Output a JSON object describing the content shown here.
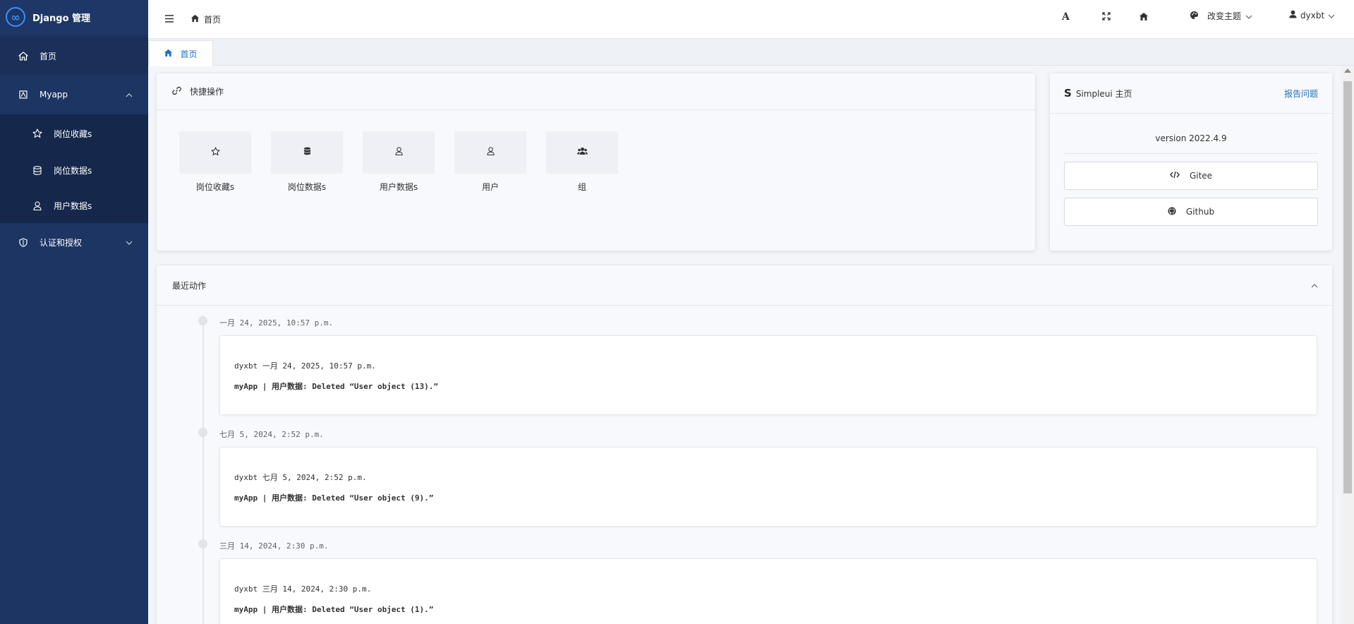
{
  "app": {
    "title": "Django 管理",
    "logo_glyph": "∞"
  },
  "sidebar": {
    "home_label": "首页",
    "groups": [
      {
        "label": "Myapp",
        "expanded": true,
        "items": [
          {
            "label": "岗位收藏s",
            "icon": "star-icon"
          },
          {
            "label": "岗位数据s",
            "icon": "database-icon"
          },
          {
            "label": "用户数据s",
            "icon": "user-icon"
          }
        ]
      },
      {
        "label": "认证和授权",
        "expanded": false
      }
    ]
  },
  "header": {
    "breadcrumb": "首页",
    "font_icon": "A",
    "theme_label": "改变主题",
    "user_name": "dyxbt"
  },
  "tabs": [
    {
      "label": "首页",
      "active": true
    }
  ],
  "quick": {
    "title": "快捷操作",
    "items": [
      {
        "label": "岗位收藏s",
        "icon": "star-icon"
      },
      {
        "label": "岗位数据s",
        "icon": "database-icon"
      },
      {
        "label": "用户数据s",
        "icon": "user-icon"
      },
      {
        "label": "用户",
        "icon": "user-icon"
      },
      {
        "label": "组",
        "icon": "users-icon"
      }
    ]
  },
  "simpleui": {
    "logo": "S",
    "title": "Simpleui 主页",
    "report_label": "报告问题",
    "version": "version 2022.4.9",
    "buttons": [
      {
        "label": "Gitee",
        "icon": "code-icon"
      },
      {
        "label": "Github",
        "icon": "github-icon"
      }
    ]
  },
  "recent": {
    "title": "最近动作",
    "entries": [
      {
        "time": "一月 24, 2025, 10:57 p.m.",
        "user_line": "dyxbt 一月 24, 2025, 10:57 p.m.",
        "message": "myApp | 用户数据: Deleted “User object (13).”"
      },
      {
        "time": "七月 5, 2024, 2:52 p.m.",
        "user_line": "dyxbt 七月 5, 2024, 2:52 p.m.",
        "message": "myApp | 用户数据: Deleted “User object (9).”"
      },
      {
        "time": "三月 14, 2024, 2:30 p.m.",
        "user_line": "dyxbt 三月 14, 2024, 2:30 p.m.",
        "message": "myApp | 用户数据: Deleted “User object (1).”"
      }
    ]
  },
  "colors": {
    "sidebar": "#1d3563",
    "accent": "#1f6fc3",
    "background": "#f3f5f9"
  }
}
